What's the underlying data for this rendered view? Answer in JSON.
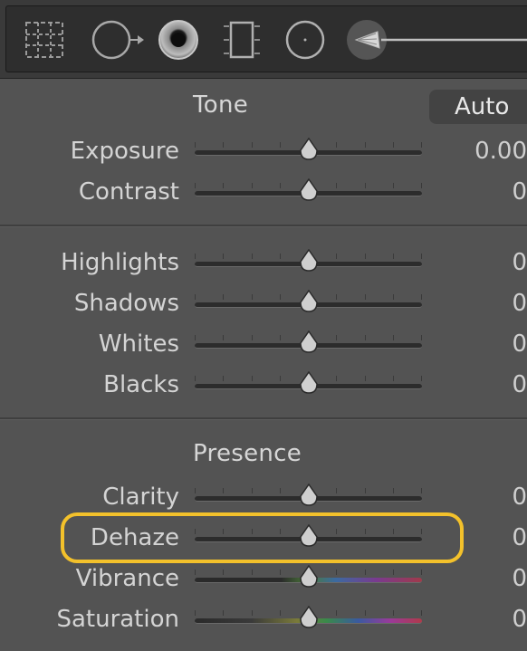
{
  "toolbar": {
    "tools": [
      {
        "name": "crop-overlay-icon"
      },
      {
        "name": "spot-removal-icon"
      },
      {
        "name": "red-eye-icon"
      },
      {
        "name": "graduated-filter-icon"
      },
      {
        "name": "radial-filter-icon"
      },
      {
        "name": "adjustment-brush-icon"
      }
    ]
  },
  "tone": {
    "title": "Tone",
    "auto_label": "Auto",
    "sliders": [
      {
        "label": "Exposure",
        "value": "0.00",
        "position": 0.5,
        "kind": "plain"
      },
      {
        "label": "Contrast",
        "value": "0",
        "position": 0.5,
        "kind": "plain"
      }
    ]
  },
  "tone2": {
    "sliders": [
      {
        "label": "Highlights",
        "value": "0",
        "position": 0.5,
        "kind": "plain"
      },
      {
        "label": "Shadows",
        "value": "0",
        "position": 0.5,
        "kind": "plain"
      },
      {
        "label": "Whites",
        "value": "0",
        "position": 0.5,
        "kind": "plain"
      },
      {
        "label": "Blacks",
        "value": "0",
        "position": 0.5,
        "kind": "plain"
      }
    ]
  },
  "presence": {
    "title": "Presence",
    "sliders": [
      {
        "label": "Clarity",
        "value": "0",
        "position": 0.5,
        "kind": "plain"
      },
      {
        "label": "Dehaze",
        "value": "0",
        "position": 0.5,
        "kind": "plain",
        "highlighted": true
      },
      {
        "label": "Vibrance",
        "value": "0",
        "position": 0.5,
        "kind": "vib"
      },
      {
        "label": "Saturation",
        "value": "0",
        "position": 0.5,
        "kind": "sat"
      }
    ]
  },
  "colors": {
    "highlight": "#f3c12b"
  }
}
